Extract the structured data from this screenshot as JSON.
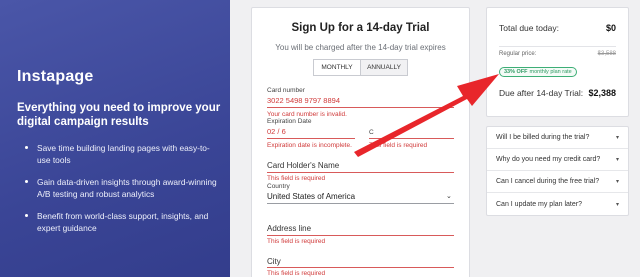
{
  "promo": {
    "logo": "Instapage",
    "headline": "Everything you need to improve your digital campaign results",
    "bullets": [
      "Save time building landing pages with easy-to-use tools",
      "Gain data-driven insights through award-winning A/B testing and robust analytics",
      "Benefit from world-class support, insights, and expert guidance"
    ]
  },
  "form": {
    "title": "Sign Up for a 14-day Trial",
    "subtitle": "You will be charged after the 14-day trial expires",
    "billing_toggle": {
      "monthly": "MONTHLY",
      "annually": "ANNUALLY",
      "selected": "MONTHLY"
    },
    "card_number": {
      "label": "Card number",
      "value": "3022 5498 9797 8894",
      "error": "Your card number is invalid."
    },
    "expiration": {
      "label": "Expiration Date",
      "value": "02 / 6",
      "error": "Expiration date is incomplete."
    },
    "cvc": {
      "label": "C",
      "error": "This field is required"
    },
    "card_holder": {
      "label": "Card Holder's Name",
      "error": "This field is required"
    },
    "country": {
      "label": "Country",
      "value": "United States of America"
    },
    "address": {
      "label": "Address line",
      "error": "This field is required"
    },
    "city": {
      "label": "City",
      "error": "This field is required"
    }
  },
  "summary": {
    "total_due_label": "Total due today:",
    "total_due_value": "$0",
    "regular_price_label": "Regular price:",
    "regular_price_value": "$3,588",
    "discount_percent": "33% OFF",
    "discount_text": "monthly plan rate",
    "after_trial_label": "Due after 14-day Trial:",
    "after_trial_value": "$2,388"
  },
  "faq": [
    "Will I be billed during the trial?",
    "Why do you need my credit card?",
    "Can I cancel during the free trial?",
    "Can I update my plan later?"
  ],
  "colors": {
    "promo_bg": "#3a4596",
    "error": "#d03a3a",
    "arrow": "#e8262b",
    "badge": "#3dae76"
  }
}
